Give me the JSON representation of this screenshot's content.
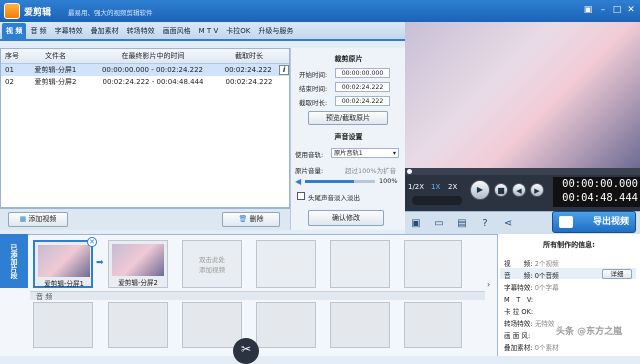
{
  "app": {
    "title": "爱剪辑",
    "subtitle": "最易用、强大的视频剪辑软件"
  },
  "tabs": [
    "视 频",
    "音 频",
    "字幕特效",
    "叠加素材",
    "转场特效",
    "画面风格",
    "M T V",
    "卡拉OK",
    "升级与服务"
  ],
  "table": {
    "headers": [
      "序号",
      "文件名",
      "在最终影片中的时间",
      "截取时长"
    ],
    "rows": [
      {
        "num": "01",
        "name": "爱剪辑-分屏1",
        "time": "00:00:00.000 - 00:02:24.222",
        "dur": "00:02:24.222"
      },
      {
        "num": "02",
        "name": "爱剪辑-分屏2",
        "time": "00:02:24.222 - 00:04:48.444",
        "dur": "00:02:24.222"
      }
    ],
    "info_icon": "i"
  },
  "buttons": {
    "add_video": "添加视频",
    "delete": "删除",
    "preview_clip": "预览/截取原片",
    "confirm": "确认修改",
    "export": "导出视频"
  },
  "clip_settings": {
    "title": "裁剪原片",
    "start_label": "开始时间:",
    "start_value": "00:00:00.000",
    "end_label": "结束时间:",
    "end_value": "00:02:24.222",
    "dur_label": "截取时长:",
    "dur_value": "00:02:24.222"
  },
  "sound_settings": {
    "title": "声音设置",
    "track_label": "使用音轨:",
    "track_value": "原片音轨1",
    "volume_label": "原片音量:",
    "volume_hint": "超过100%为扩音",
    "volume_value": "100%",
    "volume_fraction": 1.0,
    "fade_label": "头尾声音淡入淡出"
  },
  "player": {
    "speeds": [
      "1/2X",
      "1X",
      "2X"
    ],
    "time_current": "00:00:00.000",
    "time_total": "00:04:48.444"
  },
  "timeline": {
    "side_tab": "已添加片段",
    "clips": [
      "爱剪辑-分屏1",
      "爱剪辑-分屏2"
    ],
    "placeholder": "双击此处\n添加视频",
    "audio_label": "音 频"
  },
  "info": {
    "title": "所有制作的信息:",
    "rows": [
      {
        "k": "视　　频:",
        "v": "2个视频"
      },
      {
        "k": "音　　频:",
        "v": "0个音频",
        "btn": "详细"
      },
      {
        "k": "字幕特效:",
        "v": "0个字幕"
      },
      {
        "k": "M　T　V:",
        "v": ""
      },
      {
        "k": "卡 拉 OK:",
        "v": ""
      },
      {
        "k": "转场特效:",
        "v": "无特效"
      },
      {
        "k": "画 面 风:",
        "v": ""
      },
      {
        "k": "叠加素材:",
        "v": "0个素材"
      }
    ],
    "watermark": "头条 @东方之嵐"
  },
  "colors": {
    "accent": "#2e7fd2",
    "selection": "#cfe3fa"
  }
}
